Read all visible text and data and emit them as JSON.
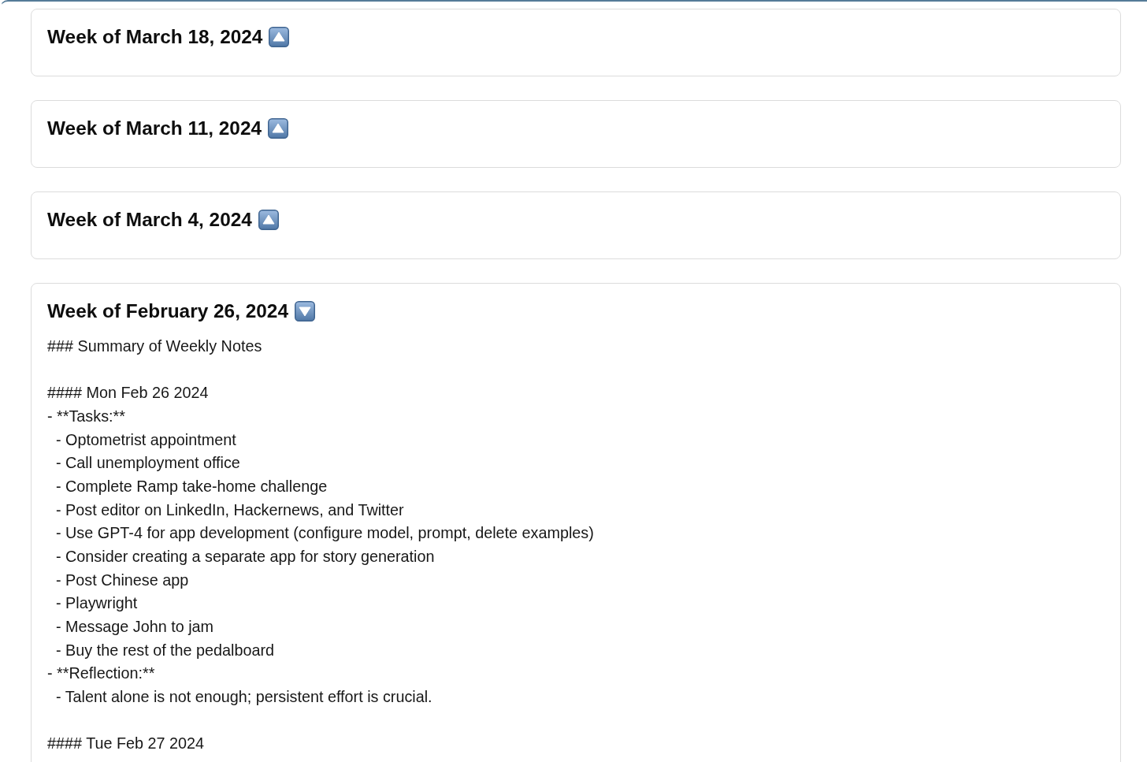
{
  "weeks": [
    {
      "title": "Week of March 18, 2024",
      "expanded": false
    },
    {
      "title": "Week of March 11, 2024",
      "expanded": false
    },
    {
      "title": "Week of March 4, 2024",
      "expanded": false
    },
    {
      "title": "Week of February 26, 2024",
      "expanded": true,
      "notes": [
        {
          "kind": "heading",
          "text": "### Summary of Weekly Notes"
        },
        {
          "kind": "day",
          "heading": "#### Mon Feb 26 2024",
          "items": [
            {
              "text": "- **Tasks:**",
              "children": [
                {
                  "text": "- Optometrist appointment"
                },
                {
                  "text": "- Call unemployment office"
                },
                {
                  "text": "- Complete Ramp take-home challenge"
                },
                {
                  "text": "- Post editor on LinkedIn, Hackernews, and Twitter"
                },
                {
                  "text": "- Use GPT-4 for app development (configure model, prompt, delete examples)"
                },
                {
                  "text": "- Consider creating a separate app for story generation"
                },
                {
                  "text": "- Post Chinese app"
                },
                {
                  "text": "- Playwright"
                },
                {
                  "text": "- Message John to jam"
                },
                {
                  "text": "- Buy the rest of the pedalboard"
                }
              ]
            },
            {
              "text": "- **Reflection:**",
              "children": [
                {
                  "text": "- Talent alone is not enough; persistent effort is crucial."
                }
              ]
            }
          ]
        },
        {
          "kind": "day",
          "heading": "#### Tue Feb 27 2024"
        }
      ]
    }
  ]
}
